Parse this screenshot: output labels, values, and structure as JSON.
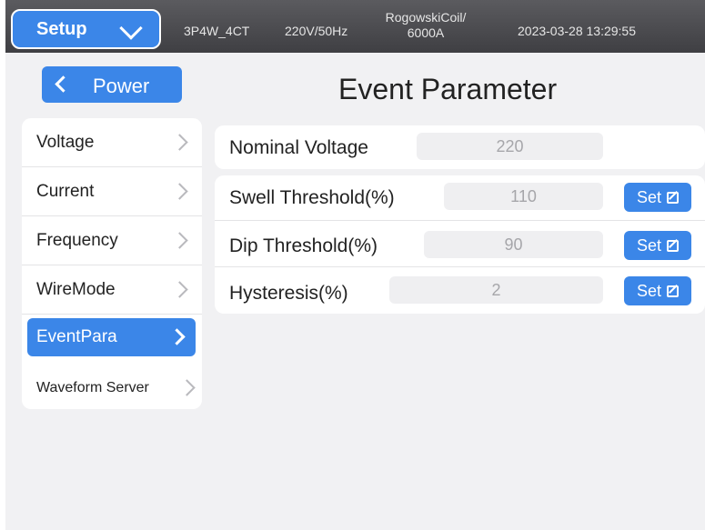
{
  "header": {
    "menu_label": "Setup",
    "wiring": "3P4W_4CT",
    "voltage_freq": "220V/50Hz",
    "sensor_line1": "RogowskiCoil/",
    "sensor_line2": "6000A",
    "datetime": "2023-03-28 13:29:55"
  },
  "sidebar": {
    "back_label": "Power",
    "items": [
      {
        "label": "Voltage",
        "active": false
      },
      {
        "label": "Current",
        "active": false
      },
      {
        "label": "Frequency",
        "active": false
      },
      {
        "label": "WireMode",
        "active": false
      },
      {
        "label": "EventPara",
        "active": true
      },
      {
        "label": "Waveform Server",
        "active": false
      }
    ]
  },
  "main": {
    "title": "Event Parameter",
    "nominal": {
      "label": "Nominal Voltage",
      "value": "220"
    },
    "params": [
      {
        "label": "Swell Threshold(%)",
        "value": "110",
        "button": "Set"
      },
      {
        "label": "Dip Threshold(%)",
        "value": "90",
        "button": "Set"
      },
      {
        "label": "Hysteresis(%)",
        "value": "2",
        "button": "Set"
      }
    ]
  },
  "colors": {
    "accent": "#3b86e8",
    "topbar": "#4a4a4e",
    "background": "#f1f1f3"
  },
  "icons": {
    "menu_toggle": "chevron-down-icon",
    "back": "chevron-left-icon",
    "nav": "chevron-right-icon",
    "edit": "edit-icon"
  }
}
